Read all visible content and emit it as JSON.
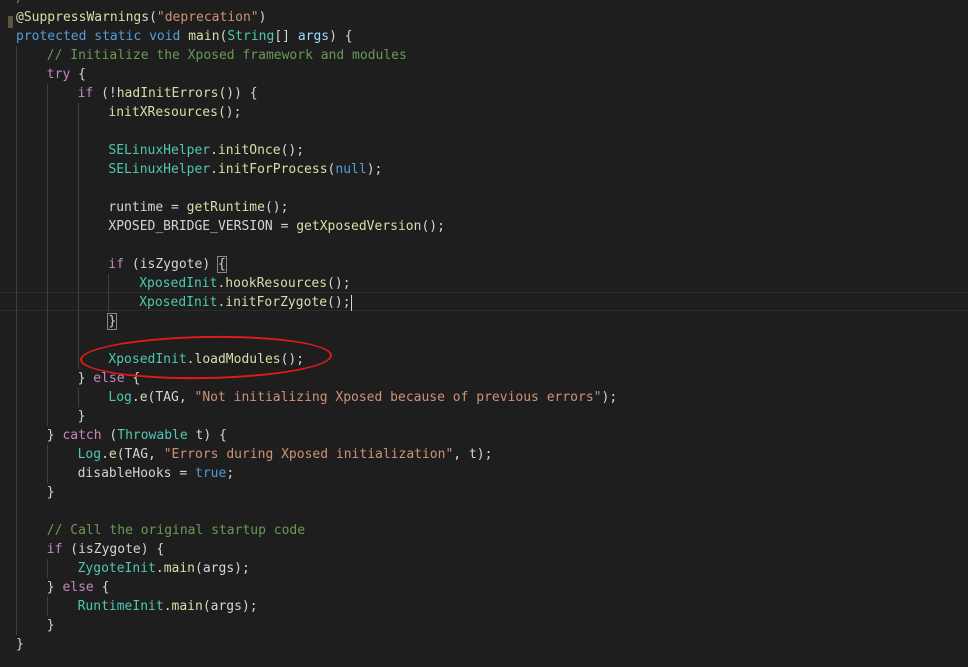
{
  "editor": {
    "lines": [
      {
        "indent": 0,
        "tokens": [
          {
            "text": "/",
            "style": "comment"
          }
        ]
      },
      {
        "indent": 0,
        "tokens": [
          {
            "text": "@SuppressWarnings",
            "style": "ann"
          },
          {
            "text": "(",
            "style": "plain"
          },
          {
            "text": "\"deprecation\"",
            "style": "str"
          },
          {
            "text": ")",
            "style": "plain"
          }
        ]
      },
      {
        "indent": 0,
        "tokens": [
          {
            "text": "protected",
            "style": "kw"
          },
          {
            "text": " ",
            "style": "plain"
          },
          {
            "text": "static",
            "style": "kw"
          },
          {
            "text": " ",
            "style": "plain"
          },
          {
            "text": "void",
            "style": "kw"
          },
          {
            "text": " ",
            "style": "plain"
          },
          {
            "text": "main",
            "style": "func"
          },
          {
            "text": "(",
            "style": "plain"
          },
          {
            "text": "String",
            "style": "type"
          },
          {
            "text": "[] ",
            "style": "plain"
          },
          {
            "text": "args",
            "style": "param"
          },
          {
            "text": ") {",
            "style": "plain"
          }
        ]
      },
      {
        "indent": 1,
        "tokens": [
          {
            "text": "// Initialize the Xposed framework and modules",
            "style": "comment"
          }
        ]
      },
      {
        "indent": 1,
        "tokens": [
          {
            "text": "try",
            "style": "ctrl"
          },
          {
            "text": " {",
            "style": "plain"
          }
        ]
      },
      {
        "indent": 2,
        "tokens": [
          {
            "text": "if",
            "style": "ctrl"
          },
          {
            "text": " (!",
            "style": "plain"
          },
          {
            "text": "hadInitErrors",
            "style": "func"
          },
          {
            "text": "()) {",
            "style": "plain"
          }
        ]
      },
      {
        "indent": 3,
        "tokens": [
          {
            "text": "initXResources",
            "style": "func"
          },
          {
            "text": "();",
            "style": "plain"
          }
        ]
      },
      {
        "indent": 3,
        "tokens": []
      },
      {
        "indent": 3,
        "tokens": [
          {
            "text": "SELinuxHelper",
            "style": "type"
          },
          {
            "text": ".",
            "style": "plain"
          },
          {
            "text": "initOnce",
            "style": "func"
          },
          {
            "text": "();",
            "style": "plain"
          }
        ]
      },
      {
        "indent": 3,
        "tokens": [
          {
            "text": "SELinuxHelper",
            "style": "type"
          },
          {
            "text": ".",
            "style": "plain"
          },
          {
            "text": "initForProcess",
            "style": "func"
          },
          {
            "text": "(",
            "style": "plain"
          },
          {
            "text": "null",
            "style": "kw"
          },
          {
            "text": ");",
            "style": "plain"
          }
        ]
      },
      {
        "indent": 3,
        "tokens": []
      },
      {
        "indent": 3,
        "tokens": [
          {
            "text": "runtime = ",
            "style": "plain"
          },
          {
            "text": "getRuntime",
            "style": "func"
          },
          {
            "text": "();",
            "style": "plain"
          }
        ]
      },
      {
        "indent": 3,
        "tokens": [
          {
            "text": "XPOSED_BRIDGE_VERSION = ",
            "style": "plain"
          },
          {
            "text": "getXposedVersion",
            "style": "func"
          },
          {
            "text": "();",
            "style": "plain"
          }
        ]
      },
      {
        "indent": 3,
        "tokens": []
      },
      {
        "indent": 3,
        "tokens": [
          {
            "text": "if",
            "style": "ctrl"
          },
          {
            "text": " (isZygote) ",
            "style": "plain"
          },
          {
            "text": "{",
            "style": "plain",
            "bracket": true
          }
        ]
      },
      {
        "indent": 4,
        "tokens": [
          {
            "text": "XposedInit",
            "style": "type"
          },
          {
            "text": ".",
            "style": "plain"
          },
          {
            "text": "hookResources",
            "style": "func"
          },
          {
            "text": "();",
            "style": "plain"
          }
        ]
      },
      {
        "indent": 4,
        "tokens": [
          {
            "text": "XposedInit",
            "style": "type"
          },
          {
            "text": ".",
            "style": "plain"
          },
          {
            "text": "initForZygote",
            "style": "func"
          },
          {
            "text": "();",
            "style": "plain"
          }
        ],
        "cursor": true
      },
      {
        "indent": 3,
        "tokens": [
          {
            "text": "}",
            "style": "plain",
            "bracket": true
          }
        ]
      },
      {
        "indent": 3,
        "tokens": []
      },
      {
        "indent": 3,
        "tokens": [
          {
            "text": "XposedInit",
            "style": "type"
          },
          {
            "text": ".",
            "style": "plain"
          },
          {
            "text": "loadModules",
            "style": "func"
          },
          {
            "text": "();",
            "style": "plain"
          }
        ]
      },
      {
        "indent": 2,
        "tokens": [
          {
            "text": "} ",
            "style": "plain"
          },
          {
            "text": "else",
            "style": "ctrl"
          },
          {
            "text": " {",
            "style": "plain"
          }
        ]
      },
      {
        "indent": 3,
        "tokens": [
          {
            "text": "Log",
            "style": "type"
          },
          {
            "text": ".",
            "style": "plain"
          },
          {
            "text": "e",
            "style": "func"
          },
          {
            "text": "(TAG, ",
            "style": "plain"
          },
          {
            "text": "\"Not initializing Xposed because of previous errors\"",
            "style": "str"
          },
          {
            "text": ");",
            "style": "plain"
          }
        ]
      },
      {
        "indent": 2,
        "tokens": [
          {
            "text": "}",
            "style": "plain"
          }
        ]
      },
      {
        "indent": 1,
        "tokens": [
          {
            "text": "} ",
            "style": "plain"
          },
          {
            "text": "catch",
            "style": "ctrl"
          },
          {
            "text": " (",
            "style": "plain"
          },
          {
            "text": "Throwable",
            "style": "type"
          },
          {
            "text": " t) {",
            "style": "plain"
          }
        ]
      },
      {
        "indent": 2,
        "tokens": [
          {
            "text": "Log",
            "style": "type"
          },
          {
            "text": ".",
            "style": "plain"
          },
          {
            "text": "e",
            "style": "func"
          },
          {
            "text": "(TAG, ",
            "style": "plain"
          },
          {
            "text": "\"Errors during Xposed initialization\"",
            "style": "str"
          },
          {
            "text": ", t);",
            "style": "plain"
          }
        ]
      },
      {
        "indent": 2,
        "tokens": [
          {
            "text": "disableHooks = ",
            "style": "plain"
          },
          {
            "text": "true",
            "style": "kw"
          },
          {
            "text": ";",
            "style": "plain"
          }
        ]
      },
      {
        "indent": 1,
        "tokens": [
          {
            "text": "}",
            "style": "plain"
          }
        ]
      },
      {
        "indent": 1,
        "tokens": []
      },
      {
        "indent": 1,
        "tokens": [
          {
            "text": "// Call the original startup code",
            "style": "comment"
          }
        ]
      },
      {
        "indent": 1,
        "tokens": [
          {
            "text": "if",
            "style": "ctrl"
          },
          {
            "text": " (isZygote) {",
            "style": "plain"
          }
        ]
      },
      {
        "indent": 2,
        "tokens": [
          {
            "text": "ZygoteInit",
            "style": "type"
          },
          {
            "text": ".",
            "style": "plain"
          },
          {
            "text": "main",
            "style": "func"
          },
          {
            "text": "(args);",
            "style": "plain"
          }
        ]
      },
      {
        "indent": 1,
        "tokens": [
          {
            "text": "} ",
            "style": "plain"
          },
          {
            "text": "else",
            "style": "ctrl"
          },
          {
            "text": " {",
            "style": "plain"
          }
        ]
      },
      {
        "indent": 2,
        "tokens": [
          {
            "text": "RuntimeInit",
            "style": "type"
          },
          {
            "text": ".",
            "style": "plain"
          },
          {
            "text": "main",
            "style": "func"
          },
          {
            "text": "(args);",
            "style": "plain"
          }
        ]
      },
      {
        "indent": 1,
        "tokens": [
          {
            "text": "}",
            "style": "plain"
          }
        ]
      },
      {
        "indent": 0,
        "tokens": [
          {
            "text": "}",
            "style": "plain"
          }
        ]
      }
    ],
    "colors": {
      "background": "#1e1e1e",
      "annotation_circle": "#e21a1a",
      "comment": "#6a9955",
      "keyword": "#569cd6",
      "control": "#c586c0",
      "type": "#4ec9b0",
      "function": "#dcdcaa",
      "string": "#ce9178"
    }
  }
}
